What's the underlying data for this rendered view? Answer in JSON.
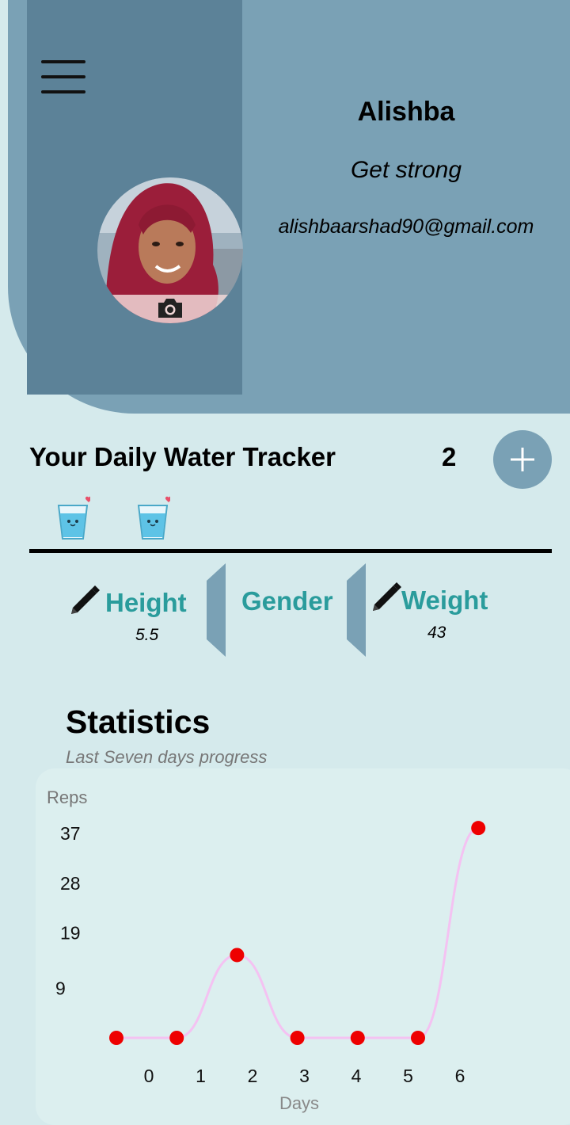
{
  "profile": {
    "name": "Alishba",
    "goal": "Get strong",
    "email": "alishbaarshad90@gmail.com"
  },
  "icons": {
    "menu": "hamburger-menu-icon",
    "camera": "camera-icon",
    "add": "plus-icon",
    "edit": "pencil-icon",
    "glass": "water-glass-icon"
  },
  "water_tracker": {
    "title": "Your Daily Water Tracker",
    "count": "2",
    "glasses": 2
  },
  "body_stats": {
    "height_label": "Height",
    "height_value": "5.5",
    "gender_label": "Gender",
    "weight_label": "Weight",
    "weight_value": "43"
  },
  "statistics": {
    "title": "Statistics",
    "subtitle": "Last Seven days progress"
  },
  "colors": {
    "header": "#7aa1b5",
    "panel": "#5c8298",
    "accent_text": "#2a9c9c",
    "point": "#ee0000",
    "line": "#f4c2f2"
  },
  "chart_data": {
    "type": "line",
    "xlabel": "Days",
    "ylabel": "Reps",
    "x": [
      0,
      1,
      2,
      3,
      4,
      5,
      6
    ],
    "x_tick_labels": [
      "0",
      "1",
      "2",
      "3",
      "4",
      "5",
      "6"
    ],
    "y_tick_labels": [
      "9",
      "19",
      "28",
      "37"
    ],
    "y_ticks": [
      9,
      19,
      28,
      37
    ],
    "values": [
      0,
      0,
      15,
      0,
      0,
      0,
      38
    ],
    "ylim": [
      0,
      40
    ],
    "grid": false,
    "legend": "none"
  }
}
